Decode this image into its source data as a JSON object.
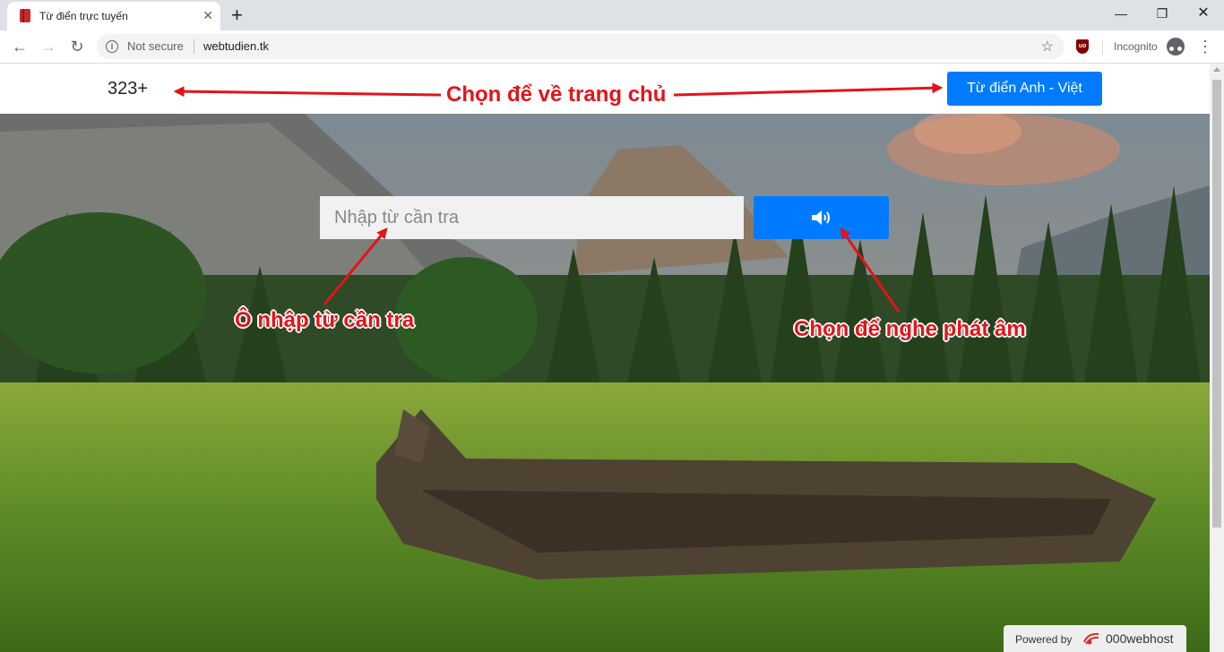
{
  "browser": {
    "tab_title": "Từ điển trực tuyến",
    "new_tab_symbol": "+",
    "security_label": "Not secure",
    "url": "webtudien.tk",
    "incognito_label": "Incognito",
    "extension_icon": "ublock-origin-icon",
    "extension_text": "uo"
  },
  "navbar": {
    "brand": "323+",
    "dict_button": "Từ điển Anh - Việt"
  },
  "search": {
    "placeholder": "Nhập từ cần tra",
    "value": ""
  },
  "annotations": {
    "home": "Chọn để về trang chủ",
    "input": "Ô nhập từ cần tra",
    "audio": "Chọn để nghe phát âm"
  },
  "footer": {
    "powered_by": "Powered by",
    "host": "000webhost"
  },
  "colors": {
    "primary_button": "#007bff",
    "annotation_text": "#e3141a",
    "annotation_arrow": "#e3141a"
  },
  "icons": {
    "audio": "speaker-volume-icon"
  }
}
